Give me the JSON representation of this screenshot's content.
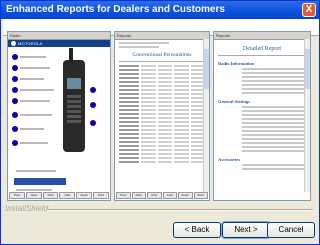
{
  "window": {
    "title": "Enhanced Reports for Dealers and Customers",
    "close_label": "X"
  },
  "pane1": {
    "title": "Radio",
    "brand": "MOTOROLA",
    "buttons": [
      "Prev",
      "Next",
      "First",
      "Last",
      "Zoom",
      "Print"
    ]
  },
  "pane2": {
    "title": "Reports",
    "doc_title": "Conventional Personalities",
    "buttons": [
      "Prev",
      "Next",
      "First",
      "Last",
      "Zoom",
      "Print"
    ]
  },
  "pane3": {
    "title": "Reports",
    "doc_title": "Detailed Report",
    "sections": [
      "Radio Information",
      "General Settings",
      "Accessories"
    ]
  },
  "footer": {
    "brand": "InstallShield",
    "back_label": "< Back",
    "next_label": "Next >",
    "cancel_label": "Cancel"
  }
}
